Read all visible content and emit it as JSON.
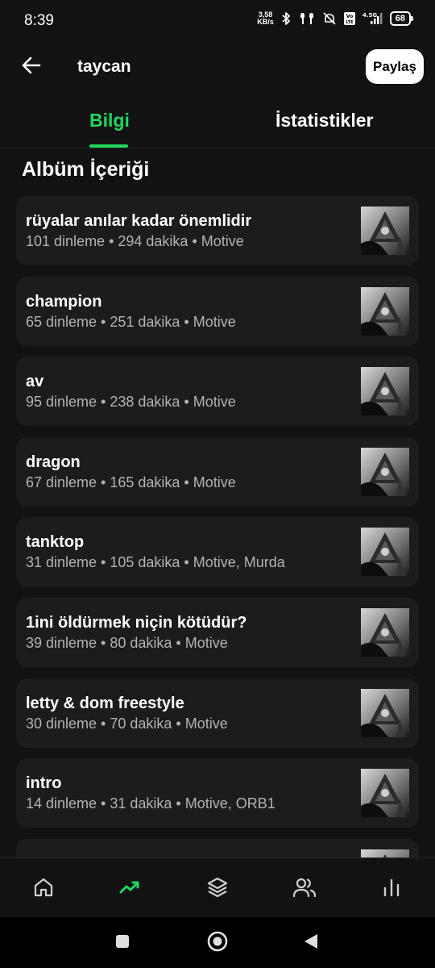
{
  "status_bar": {
    "time": "8:39",
    "net_speed_value": "3,58",
    "net_speed_unit": "KB/s",
    "lte_label": "Vo LTE",
    "network_label": "4.5G",
    "battery": "68"
  },
  "header": {
    "title": "taycan",
    "share_label": "Paylaş"
  },
  "tabs": [
    {
      "label": "Bilgi",
      "active": true
    },
    {
      "label": "İstatistikler",
      "active": false
    }
  ],
  "section_title": "Albüm İçeriği",
  "tracks": [
    {
      "title": "rüyalar anılar kadar önemlidir",
      "meta": "101 dinleme • 294 dakika • Motive"
    },
    {
      "title": "champion",
      "meta": "65 dinleme • 251 dakika • Motive"
    },
    {
      "title": "av",
      "meta": "95 dinleme • 238 dakika • Motive"
    },
    {
      "title": "dragon",
      "meta": "67 dinleme • 165 dakika • Motive"
    },
    {
      "title": "tanktop",
      "meta": "31 dinleme • 105 dakika • Motive, Murda"
    },
    {
      "title": "1ini öldürmek niçin kötüdür?",
      "meta": "39 dinleme • 80 dakika • Motive"
    },
    {
      "title": "letty & dom freestyle",
      "meta": "30 dinleme • 70 dakika • Motive"
    },
    {
      "title": "intro",
      "meta": "14 dinleme • 31 dakika • Motive, ORB1"
    },
    {
      "title": "",
      "meta": ""
    }
  ],
  "bottom_nav": [
    {
      "icon": "home-icon",
      "active": false
    },
    {
      "icon": "trending-icon",
      "active": true
    },
    {
      "icon": "layers-icon",
      "active": false
    },
    {
      "icon": "users-icon",
      "active": false
    },
    {
      "icon": "bar-chart-icon",
      "active": false
    }
  ],
  "colors": {
    "accent": "#1ed760",
    "background": "#121212",
    "card": "#1c1c1c",
    "secondary_text": "#b3b3b3"
  }
}
